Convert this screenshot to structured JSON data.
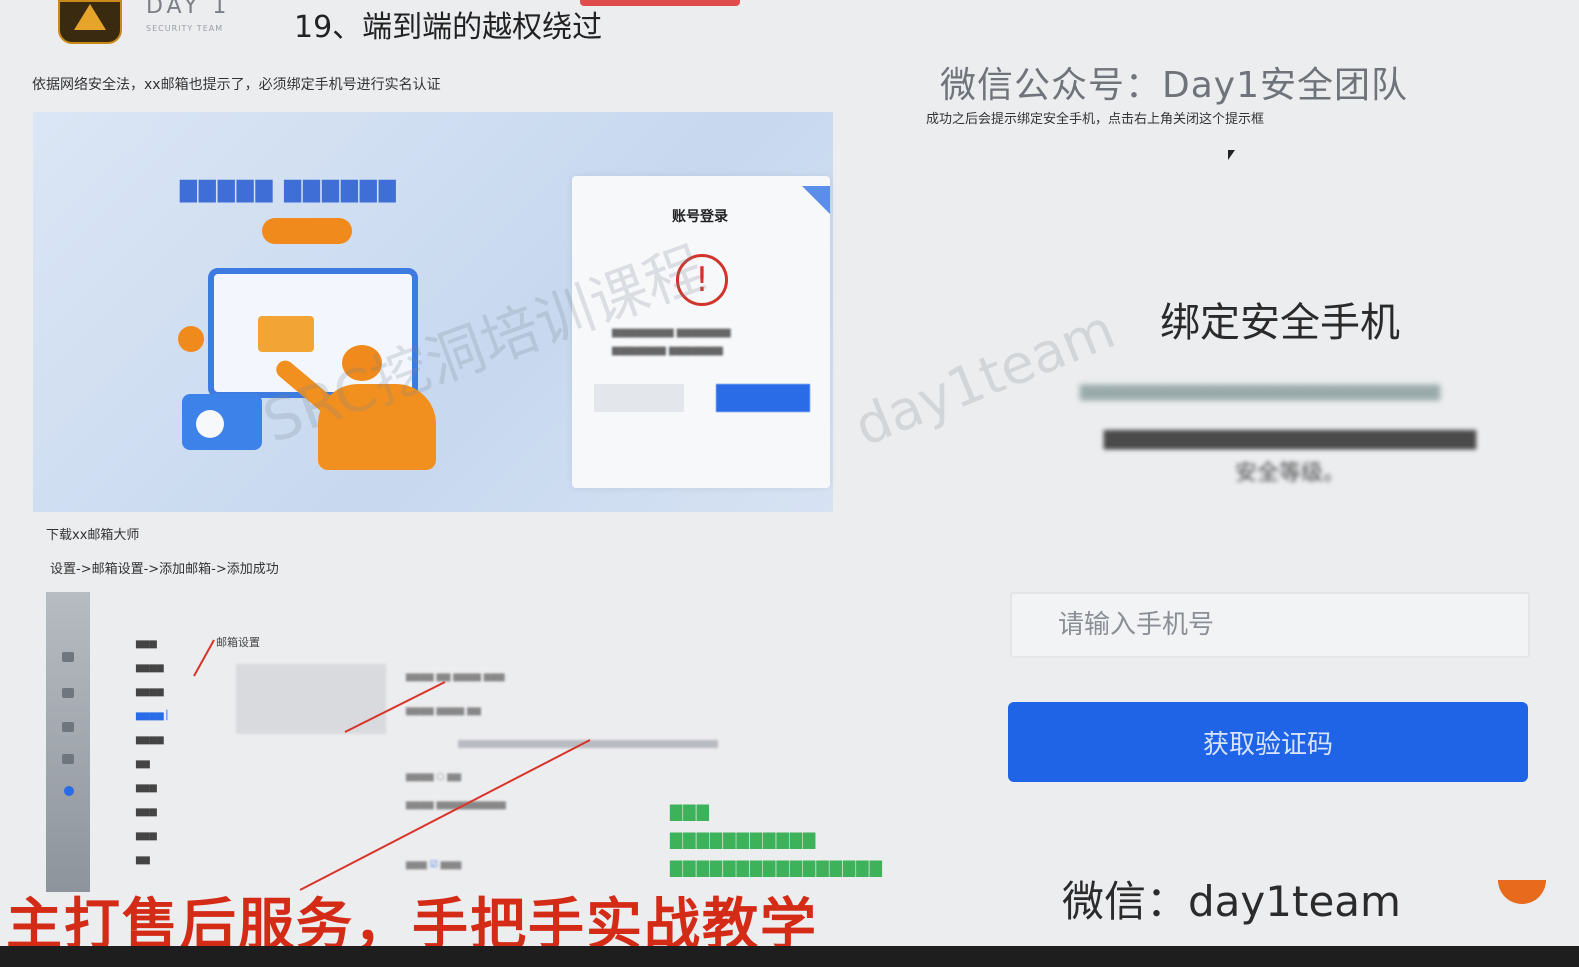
{
  "header": {
    "brand": "DAY 1",
    "brand_sub": "SECURITY TEAM",
    "slide_title": "19、端到端的越权绕过"
  },
  "notes": {
    "left": "依据网络安全法，xx邮箱也提示了，必须绑定手机号进行实名认证",
    "wechat_account": "微信公众号：Day1安全团队",
    "right": "成功之后会提示绑定安全手机，点击右上角关闭这个提示框"
  },
  "login_dialog": {
    "title": "账号登录",
    "warning_glyph": "!"
  },
  "steps": {
    "download": "下载xx邮箱大师",
    "path": "设置->邮箱设置->添加邮箱->添加成功"
  },
  "settings_panel": {
    "title": "邮箱设置"
  },
  "watermarks": {
    "left": "SRC挖洞培训课程",
    "right": "day1team"
  },
  "bind_phone": {
    "title": "绑定安全手机",
    "desc_line": "安全等级。",
    "input_placeholder": "请输入手机号",
    "button_label": "获取验证码"
  },
  "footer": {
    "wechat": "微信：day1team",
    "slogan": "主打售后服务，手把手实战教学"
  },
  "colors": {
    "accent_blue": "#1f63e6",
    "slogan_red": "#d42b17",
    "warning_red": "#d0342c",
    "orange": "#f08a1c"
  }
}
